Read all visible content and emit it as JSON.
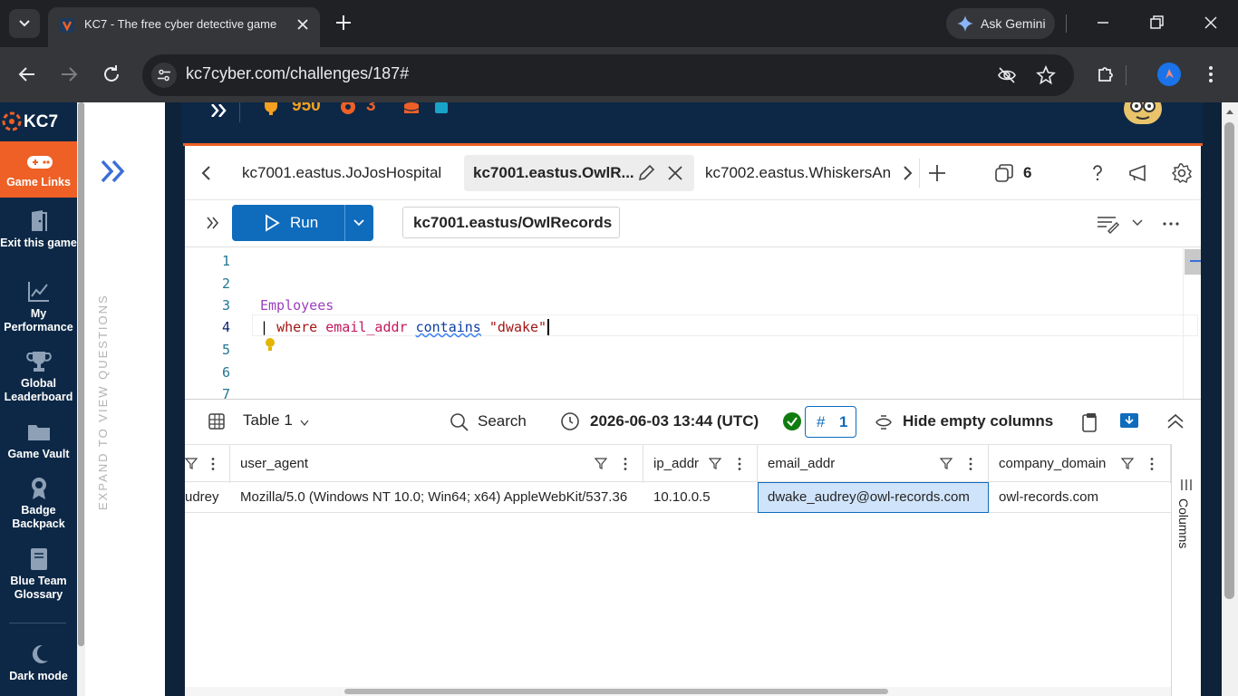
{
  "browser": {
    "tab_title": "KC7 - The free cyber detective game",
    "url": "kc7cyber.com/challenges/187#",
    "gemini_label": "Ask Gemini"
  },
  "kc7": {
    "logo_text": "KC7",
    "nav": [
      {
        "label": "Game Links",
        "icon": "gamepad-icon"
      },
      {
        "label": "Exit this game",
        "icon": "exit-door-icon"
      },
      {
        "label": "My Performance",
        "icon": "line-chart-icon"
      },
      {
        "label": "Global Leaderboard",
        "icon": "trophy-icon"
      },
      {
        "label": "Game Vault",
        "icon": "folder-icon"
      },
      {
        "label": "Badge Backpack",
        "icon": "badge-icon"
      },
      {
        "label": "Blue Team Glossary",
        "icon": "book-icon"
      },
      {
        "label": "Dark mode",
        "icon": "moon-icon"
      }
    ],
    "expand_label": "EXPAND TO VIEW QUESTIONS",
    "score": "950",
    "streak": "3",
    "accent": "#ee6026",
    "nav_bg": "#0d2846"
  },
  "adx": {
    "tabs": [
      {
        "label": "kc7001.eastus.JoJosHospital"
      },
      {
        "label": "kc7001.eastus.OwlR..."
      },
      {
        "label": "kc7002.eastus.WhiskersAn"
      }
    ],
    "tab_count": "6",
    "run_label": "Run",
    "database": "kc7001.eastus/OwlRecords",
    "line_numbers": [
      "1",
      "2",
      "3",
      "4",
      "5",
      "6",
      "7"
    ],
    "code": {
      "line3": "Employees",
      "line4_pipe": "| ",
      "line4_where": "where",
      "line4_field": "email_addr",
      "line4_op": "contains",
      "line4_str": "\"dwake\""
    },
    "results": {
      "table_label": "Table 1",
      "search_label": "Search",
      "timestamp": "2026-06-03 13:44 (UTC)",
      "row_count_symbol": "#",
      "row_count": "1",
      "hide_empty_label": "Hide empty columns",
      "columns_label": "Columns",
      "headers": [
        "user_agent",
        "ip_addr",
        "email_addr",
        "company_domain"
      ],
      "row": {
        "partial": "udrey",
        "user_agent": "Mozilla/5.0 (Windows NT 10.0; Win64; x64) AppleWebKit/537.36",
        "ip_addr": "10.10.0.5",
        "email_addr": "dwake_audrey@owl-records.com",
        "company_domain": "owl-records.com"
      }
    },
    "accent": "#0f6cbd"
  }
}
